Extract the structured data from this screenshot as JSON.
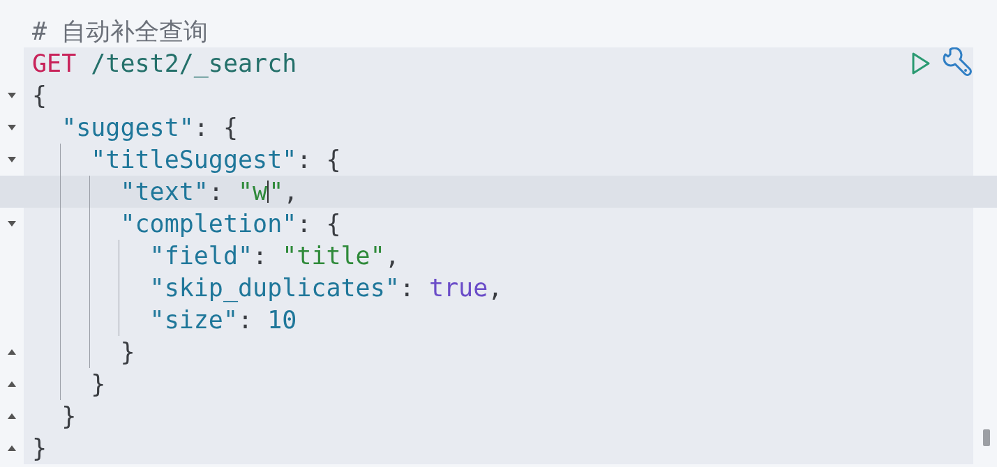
{
  "comment": {
    "text": "# 自动补全查询"
  },
  "request": {
    "actions": [
      {
        "kind": "run"
      },
      {
        "kind": "settings"
      }
    ],
    "lines": [
      {
        "fold_start": false,
        "fold_end": false,
        "active": false,
        "tokens": [
          {
            "kind": "method",
            "text": "GET"
          },
          {
            "kind": "url",
            "text": " /test2/_search"
          }
        ]
      },
      {
        "fold_start": true,
        "fold_end": false,
        "active": false,
        "tokens": [
          {
            "kind": "punct",
            "text": "{"
          }
        ]
      },
      {
        "fold_start": true,
        "fold_end": false,
        "active": false,
        "tokens": [
          {
            "kind": "key",
            "text": "  \"suggest\""
          },
          {
            "kind": "punct",
            "text": ": {"
          }
        ]
      },
      {
        "fold_start": true,
        "fold_end": false,
        "active": false,
        "tokens": [
          {
            "kind": "key",
            "text": "    \"titleSuggest\""
          },
          {
            "kind": "punct",
            "text": ": {"
          }
        ]
      },
      {
        "fold_start": false,
        "fold_end": false,
        "active": true,
        "tokens": [
          {
            "kind": "key",
            "text": "      \"text\""
          },
          {
            "kind": "punct",
            "text": ": "
          },
          {
            "kind": "string",
            "text": "\"w",
            "cursor": true
          },
          {
            "kind": "string",
            "text": "\""
          },
          {
            "kind": "punct",
            "text": ","
          }
        ]
      },
      {
        "fold_start": true,
        "fold_end": false,
        "active": false,
        "tokens": [
          {
            "kind": "key",
            "text": "      \"completion\""
          },
          {
            "kind": "punct",
            "text": ": {"
          }
        ]
      },
      {
        "fold_start": false,
        "fold_end": false,
        "active": false,
        "tokens": [
          {
            "kind": "key",
            "text": "        \"field\""
          },
          {
            "kind": "punct",
            "text": ": "
          },
          {
            "kind": "string",
            "text": "\"title\""
          },
          {
            "kind": "punct",
            "text": ","
          }
        ]
      },
      {
        "fold_start": false,
        "fold_end": false,
        "active": false,
        "tokens": [
          {
            "kind": "key",
            "text": "        \"skip_duplicates\""
          },
          {
            "kind": "punct",
            "text": ": "
          },
          {
            "kind": "boolean",
            "text": "true"
          },
          {
            "kind": "punct",
            "text": ","
          }
        ]
      },
      {
        "fold_start": false,
        "fold_end": false,
        "active": false,
        "tokens": [
          {
            "kind": "key",
            "text": "        \"size\""
          },
          {
            "kind": "punct",
            "text": ": "
          },
          {
            "kind": "number",
            "text": "10"
          }
        ]
      },
      {
        "fold_start": false,
        "fold_end": true,
        "active": false,
        "tokens": [
          {
            "kind": "punct",
            "text": "      }"
          }
        ]
      },
      {
        "fold_start": false,
        "fold_end": true,
        "active": false,
        "tokens": [
          {
            "kind": "punct",
            "text": "    }"
          }
        ]
      },
      {
        "fold_start": false,
        "fold_end": true,
        "active": false,
        "tokens": [
          {
            "kind": "punct",
            "text": "  }"
          }
        ]
      },
      {
        "fold_start": false,
        "fold_end": true,
        "active": false,
        "tokens": [
          {
            "kind": "punct",
            "text": "}"
          }
        ]
      }
    ]
  }
}
